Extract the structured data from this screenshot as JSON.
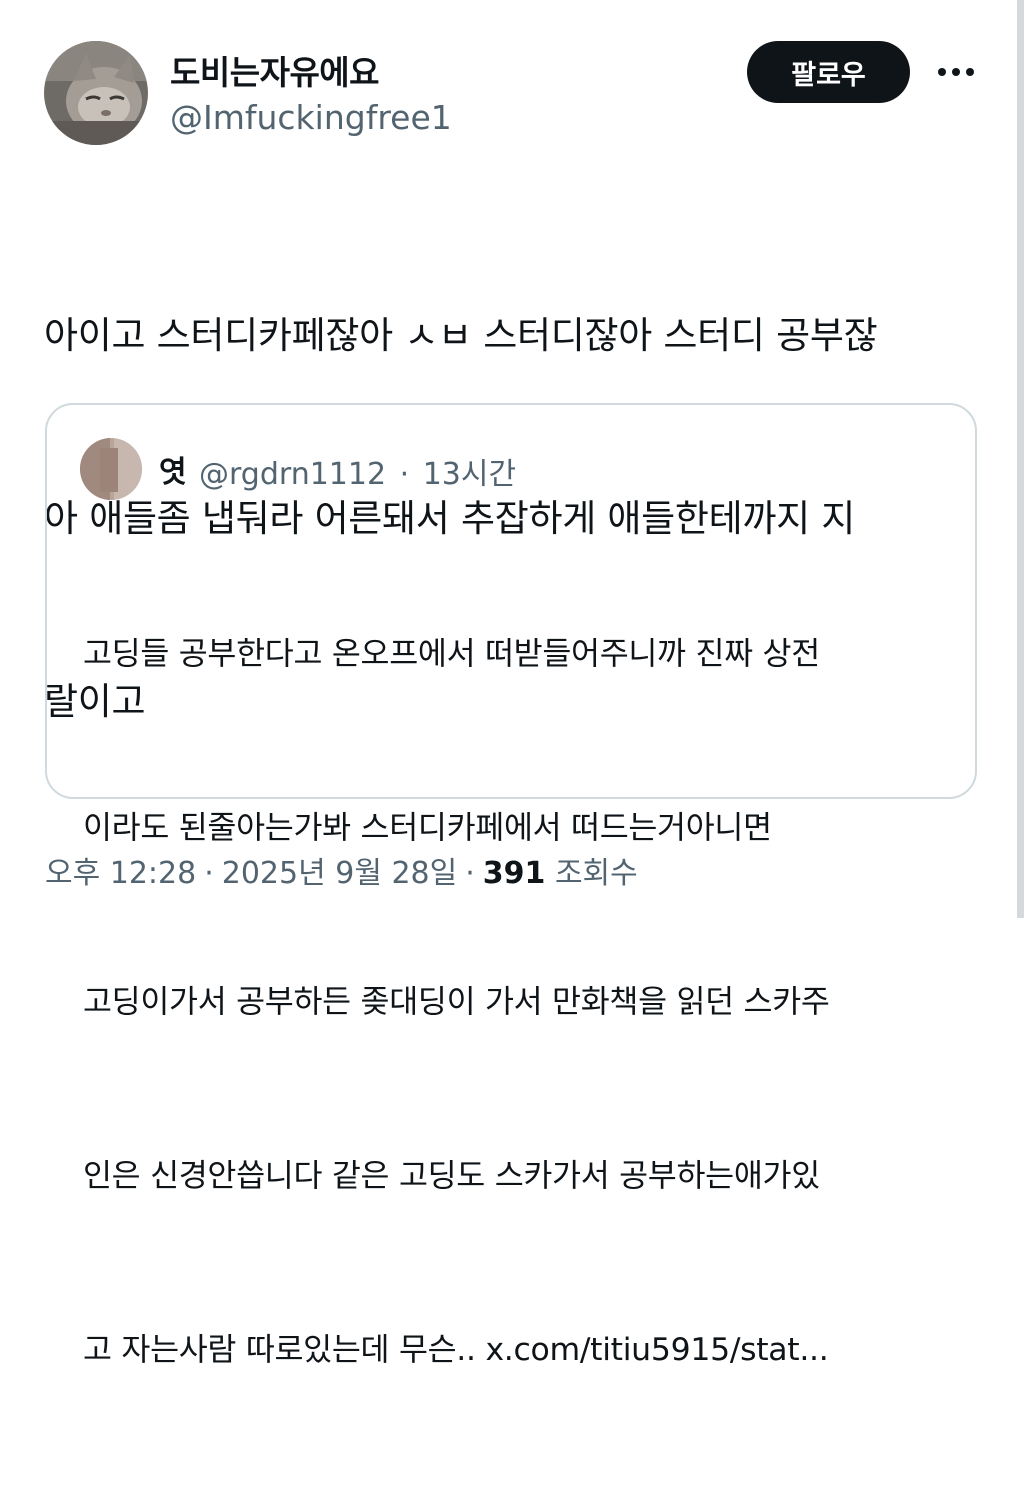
{
  "author": {
    "display_name": "도비는자유에요",
    "handle": "@Imfuckingfree1",
    "avatar_icon": "cat-avatar-icon"
  },
  "actions": {
    "follow_label": "팔로우",
    "more_icon": "ellipsis-icon"
  },
  "tweet": {
    "text_lines": [
      "아이고 스터디카페잖아 ㅅㅂ 스터디잖아 스터디 공부잖",
      "아 애들좀 냅둬라 어른돼서 추잡하게 애들한테까지 지",
      "랄이고"
    ]
  },
  "quoted_tweet": {
    "display_name": "엿",
    "handle": "@rgdrn1112",
    "separator": "·",
    "time": "13시간",
    "text_lines": [
      "고딩들 공부한다고 온오프에서 떠받들어주니까 진짜 상전",
      "이라도 된줄아는가봐 스터디카페에서 떠드는거아니면 ",
      "고딩이가서 공부하든 좆대딩이 가서 만화책을 읽던 스카주",
      "인은 신경안씁니다 같은 고딩도 스카가서 공부하는애가있",
      "고 자는사람 따로있는데 무슨.. x.com/titiu5915/stat..."
    ]
  },
  "footer": {
    "time": "오후 12:28",
    "sep1": "·",
    "date": "2025년 9월 28일",
    "sep2": "·",
    "views_count": "391",
    "views_label": "조회수"
  },
  "colors": {
    "text": "#0f1419",
    "secondary": "#536471",
    "border": "#cfd9de",
    "button_bg": "#0f1419"
  }
}
